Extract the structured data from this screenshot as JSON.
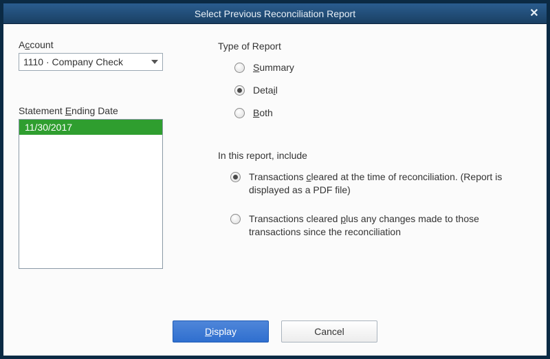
{
  "window": {
    "title": "Select Previous Reconciliation Report"
  },
  "account": {
    "label_pre": "A",
    "label_ul": "c",
    "label_post": "count",
    "selected": "1110 · Company Check"
  },
  "statement": {
    "label_pre": "Statement ",
    "label_ul": "E",
    "label_post": "nding Date",
    "dates": [
      "11/30/2017"
    ]
  },
  "report_type": {
    "heading": "Type of Report",
    "summary_ul": "S",
    "summary_post": "ummary",
    "detail_pre": "Deta",
    "detail_ul": "i",
    "detail_post": "l",
    "both_ul": "B",
    "both_post": "oth",
    "selected": "detail"
  },
  "include": {
    "heading": "In this report, include",
    "opt1_pre": "Transactions ",
    "opt1_ul": "c",
    "opt1_post": "leared at the time of reconciliation. (Report is displayed as a PDF file)",
    "opt2_pre": "Transactions cleared ",
    "opt2_ul": "p",
    "opt2_post": "lus any changes made to those transactions since the reconciliation",
    "selected": "opt1"
  },
  "buttons": {
    "display_ul": "D",
    "display_post": "isplay",
    "cancel": "Cancel"
  }
}
